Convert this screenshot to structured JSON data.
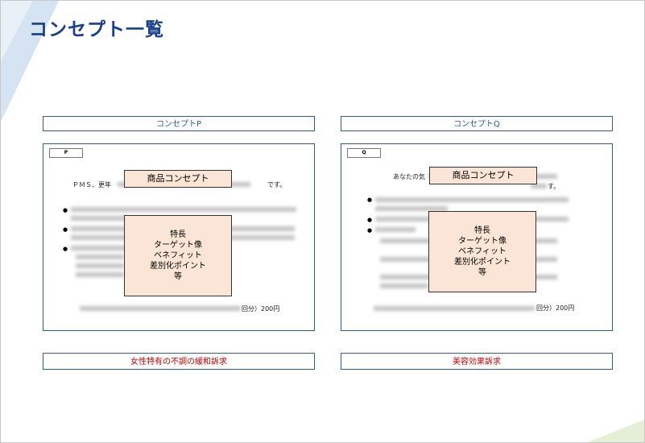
{
  "page": {
    "title": "コンセプト一覧"
  },
  "columns": [
    {
      "header": "コンセプトP",
      "tag": "P",
      "intro_prefix": "ＰＭＳ、更年",
      "intro_suffix": "です。",
      "overlay_label": "商品コンセプト",
      "features": [
        "特長",
        "ターゲット像",
        "ベネフィット",
        "差別化ポイント",
        "等"
      ],
      "price_suffix": "回分）200円",
      "appeal": "女性特有の不調の緩和訴求"
    },
    {
      "header": "コンセプトQ",
      "tag": "Q",
      "intro_prefix": "あなたの気",
      "intro_suffix": "す。",
      "overlay_label": "商品コンセプト",
      "features": [
        "特長",
        "ターゲット像",
        "ベネフィット",
        "差別化ポイント",
        "等"
      ],
      "price_suffix": "回分）200円",
      "appeal": "美容効果訴求"
    }
  ],
  "colors": {
    "title": "#1a3f8c",
    "border": "#2e5b96",
    "appeal_text": "#c00000",
    "overlay_fill": "#fbe5d6"
  }
}
